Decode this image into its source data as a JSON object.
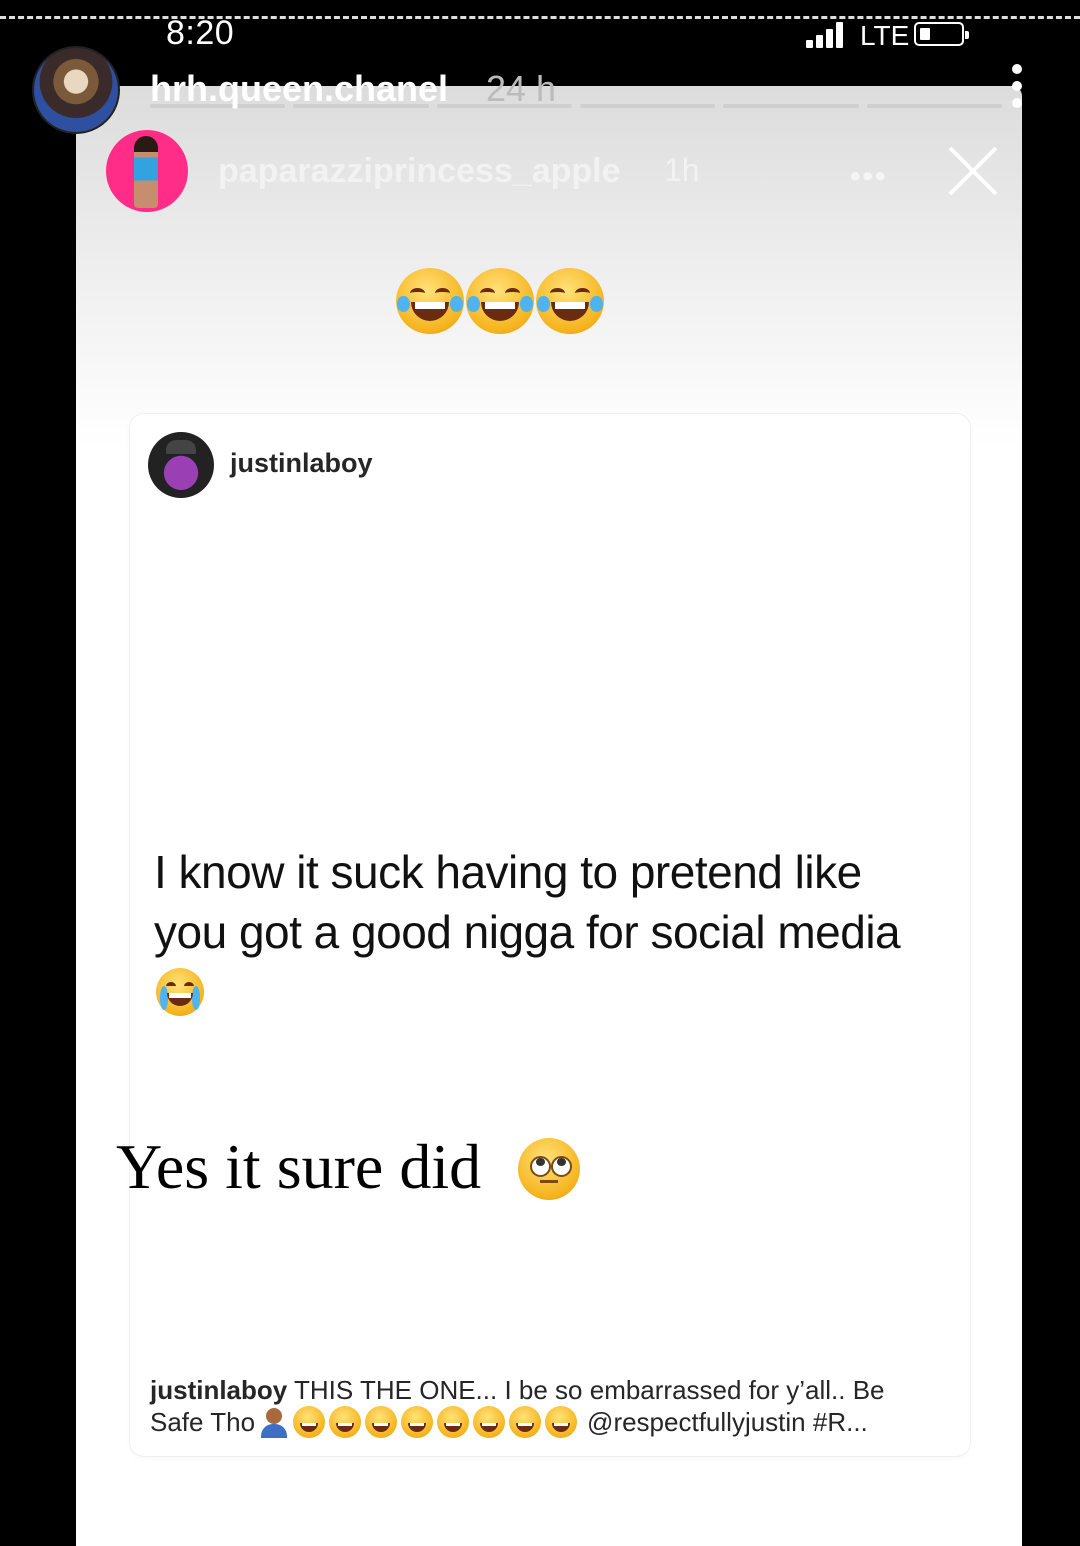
{
  "status_bar": {
    "time": "8:20",
    "network": "LTE"
  },
  "outer_story": {
    "username": "hrh.queen.chanel",
    "age": "24 h"
  },
  "inner_story": {
    "username": "paparazziprincess_apple",
    "age": "1h",
    "more": "•••"
  },
  "post": {
    "username": "justinlaboy",
    "tweet_line1": "I know it suck having to pretend like",
    "tweet_line2": "you got a good nigga for social media",
    "caption_user": "justinlaboy",
    "caption_text": "THIS THE ONE... I be so embarrassed for y’all.. Be",
    "caption_line2_start": "Safe Tho",
    "caption_line2_end": "@respectfullyjustin #R..."
  },
  "reply": {
    "text": "Yes it sure did"
  },
  "icons": {
    "top_emojis": [
      "laughing-crying-emoji",
      "laughing-crying-emoji",
      "laughing-crying-emoji"
    ],
    "tweet_emoji": "loudly-crying-emoji",
    "reply_emoji": "eye-roll-emoji"
  }
}
